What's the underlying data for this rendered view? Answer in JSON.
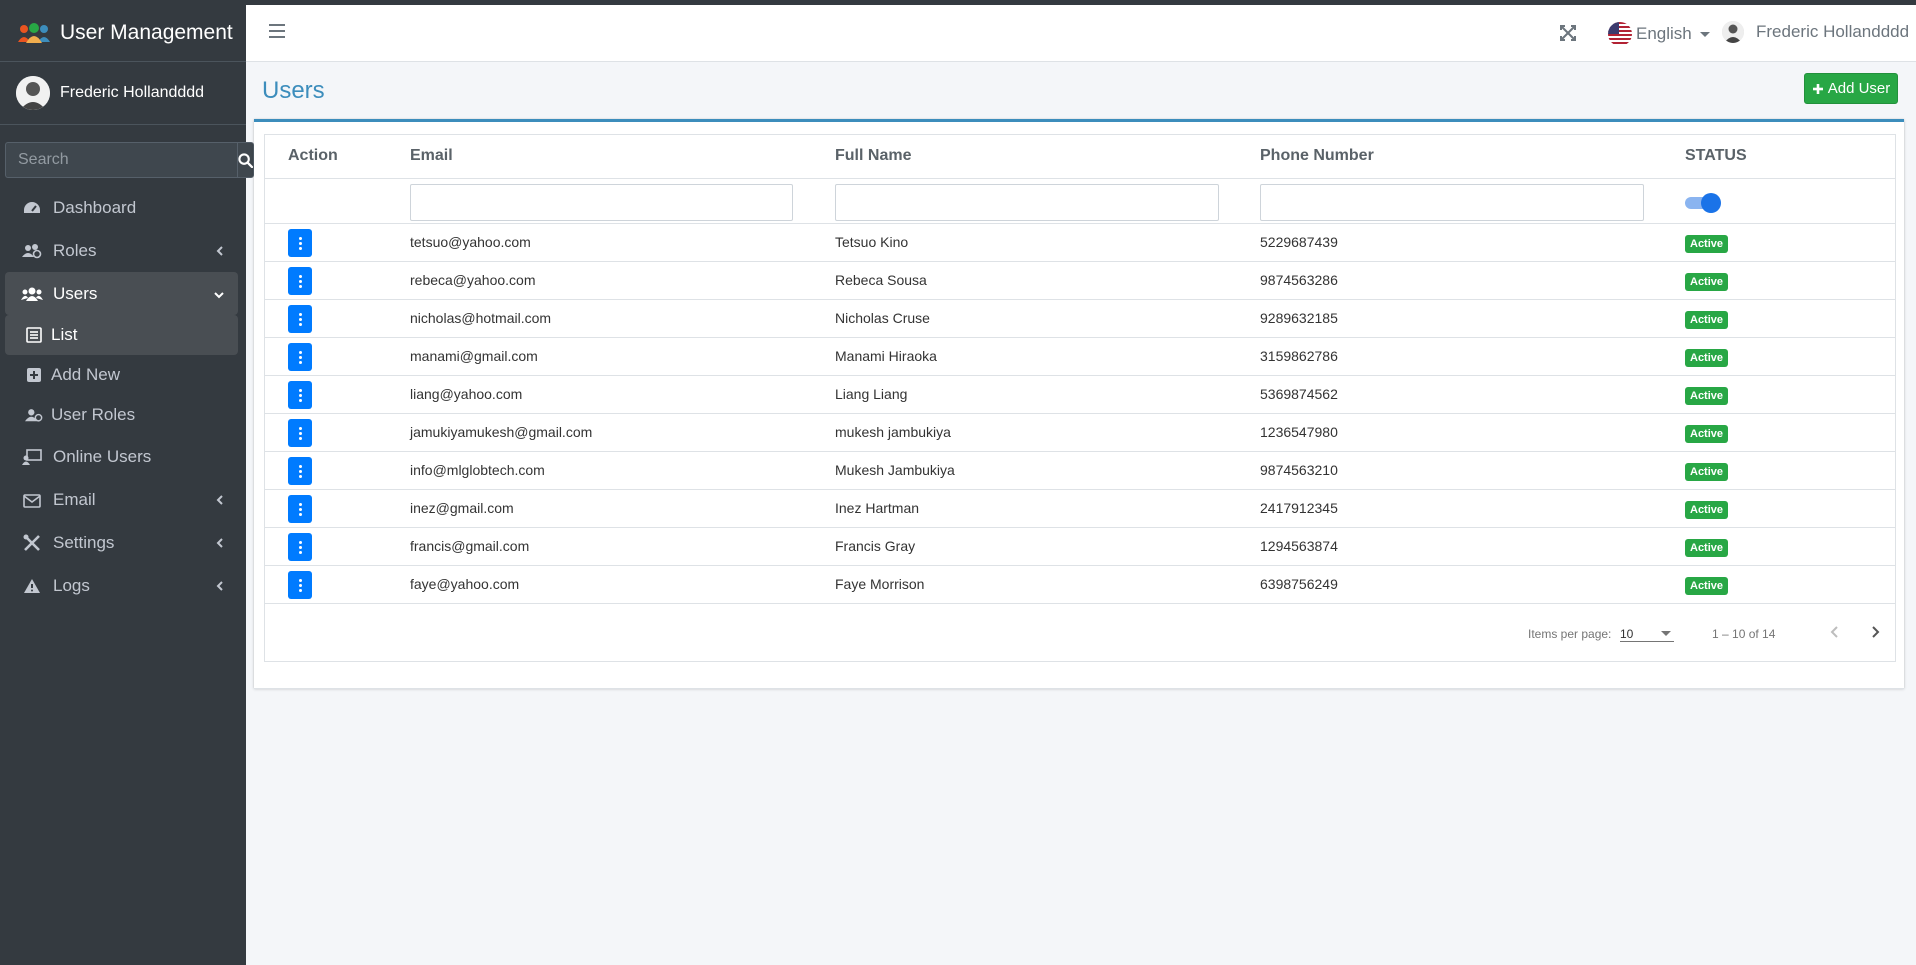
{
  "app": {
    "title": "User Management"
  },
  "sidebar": {
    "user_name": "Frederic Hollandddd",
    "search_placeholder": "Search",
    "items": [
      {
        "label": "Dashboard",
        "icon": "dashboard-icon"
      },
      {
        "label": "Roles",
        "icon": "roles-icon"
      },
      {
        "label": "Users",
        "icon": "users-icon"
      },
      {
        "label": "List",
        "icon": "list-icon"
      },
      {
        "label": "Add New",
        "icon": "plus-square-icon"
      },
      {
        "label": "User Roles",
        "icon": "user-lock-icon"
      },
      {
        "label": "Online Users",
        "icon": "chalkboard-user-icon"
      },
      {
        "label": "Email",
        "icon": "envelope-icon"
      },
      {
        "label": "Settings",
        "icon": "tools-icon"
      },
      {
        "label": "Logs",
        "icon": "warning-icon"
      }
    ]
  },
  "header": {
    "language": "English",
    "user_name": "Frederic Hollandddd"
  },
  "main": {
    "title": "Users",
    "add_button": "Add User",
    "columns": [
      "Action",
      "Email",
      "Full Name",
      "Phone Number",
      "STATUS"
    ],
    "rows": [
      {
        "email": "tetsuo@yahoo.com",
        "name": "Tetsuo Kino",
        "phone": "5229687439",
        "status": "Active"
      },
      {
        "email": "rebeca@yahoo.com",
        "name": "Rebeca Sousa",
        "phone": "9874563286",
        "status": "Active"
      },
      {
        "email": "nicholas@hotmail.com",
        "name": "Nicholas Cruse",
        "phone": "9289632185",
        "status": "Active"
      },
      {
        "email": "manami@gmail.com",
        "name": "Manami Hiraoka",
        "phone": "3159862786",
        "status": "Active"
      },
      {
        "email": "liang@yahoo.com",
        "name": "Liang Liang",
        "phone": "5369874562",
        "status": "Active"
      },
      {
        "email": "jamukiyamukesh@gmail.com",
        "name": "mukesh jambukiya",
        "phone": "1236547980",
        "status": "Active"
      },
      {
        "email": "info@mlglobtech.com",
        "name": "Mukesh Jambukiya",
        "phone": "9874563210",
        "status": "Active"
      },
      {
        "email": "inez@gmail.com",
        "name": "Inez Hartman",
        "phone": "2417912345",
        "status": "Active"
      },
      {
        "email": "francis@gmail.com",
        "name": "Francis Gray",
        "phone": "1294563874",
        "status": "Active"
      },
      {
        "email": "faye@yahoo.com",
        "name": "Faye Morrison",
        "phone": "6398756249",
        "status": "Active"
      }
    ],
    "status_filter_on": true,
    "paginator": {
      "label": "Items per page:",
      "page_size": "10",
      "range": "1 – 10 of 14"
    }
  },
  "colors": {
    "sidebar_bg": "#343a40",
    "accent_blue": "#3c8dbc",
    "action_blue": "#007bff",
    "success_green": "#28a745"
  }
}
